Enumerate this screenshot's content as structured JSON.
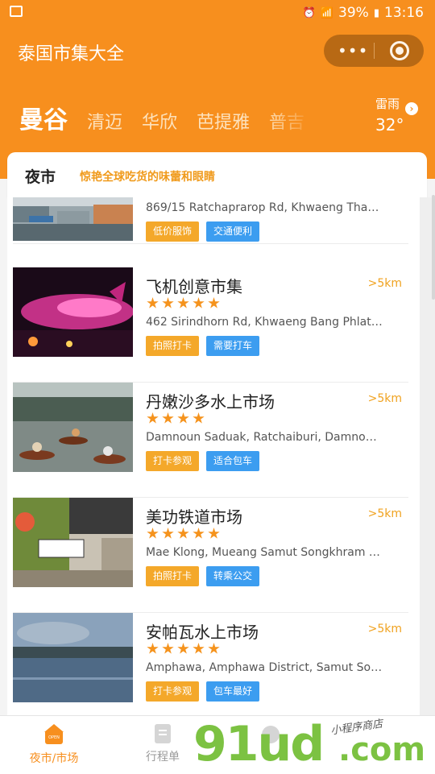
{
  "status_bar": {
    "battery": "39%",
    "time": "13:16"
  },
  "header": {
    "title": "泰国市集大全",
    "cities": [
      "曼谷",
      "清迈",
      "华欣",
      "芭提雅",
      "普吉"
    ],
    "weather": {
      "condition": "雷雨",
      "temperature": "32°"
    }
  },
  "category": {
    "title": "夜市",
    "subtitle": "惊艳全球吃货的味蕾和眼睛"
  },
  "markets": [
    {
      "name": "",
      "distance": "",
      "rating": 0,
      "address": "869/15 Ratchaprarop Rd, Khwaeng Tha…",
      "tags": [
        {
          "label": "低价服饰",
          "color": "orange"
        },
        {
          "label": "交通便利",
          "color": "blue"
        }
      ]
    },
    {
      "name": "飞机创意市集",
      "distance": ">5km",
      "rating": 5,
      "address": "462 Sirindhorn Rd, Khwaeng Bang Phlat…",
      "tags": [
        {
          "label": "拍照打卡",
          "color": "orange"
        },
        {
          "label": "需要打车",
          "color": "blue"
        }
      ]
    },
    {
      "name": "丹嫩沙多水上市场",
      "distance": ">5km",
      "rating": 4,
      "address": "Damnoun Saduak, Ratchaiburi, Damno…",
      "tags": [
        {
          "label": "打卡参观",
          "color": "orange"
        },
        {
          "label": "适合包车",
          "color": "blue"
        }
      ]
    },
    {
      "name": "美功铁道市场",
      "distance": ">5km",
      "rating": 5,
      "address": "Mae Klong, Mueang Samut Songkhram …",
      "tags": [
        {
          "label": "拍照打卡",
          "color": "orange"
        },
        {
          "label": "转乘公交",
          "color": "blue"
        }
      ]
    },
    {
      "name": "安帕瓦水上市场",
      "distance": ">5km",
      "rating": 5,
      "address": "Amphawa, Amphawa District, Samut So…",
      "tags": [
        {
          "label": "打卡参观",
          "color": "orange"
        },
        {
          "label": "包车最好",
          "color": "blue"
        }
      ]
    }
  ],
  "tabbar": {
    "items": [
      {
        "label": "夜市/市场",
        "icon": "open-shop-icon"
      },
      {
        "label": "行程单",
        "icon": "itinerary-icon"
      },
      {
        "label": "",
        "icon": "generic-icon"
      }
    ]
  },
  "watermark": {
    "big": "91ud",
    "com": ".com",
    "small": "小程序商店"
  }
}
